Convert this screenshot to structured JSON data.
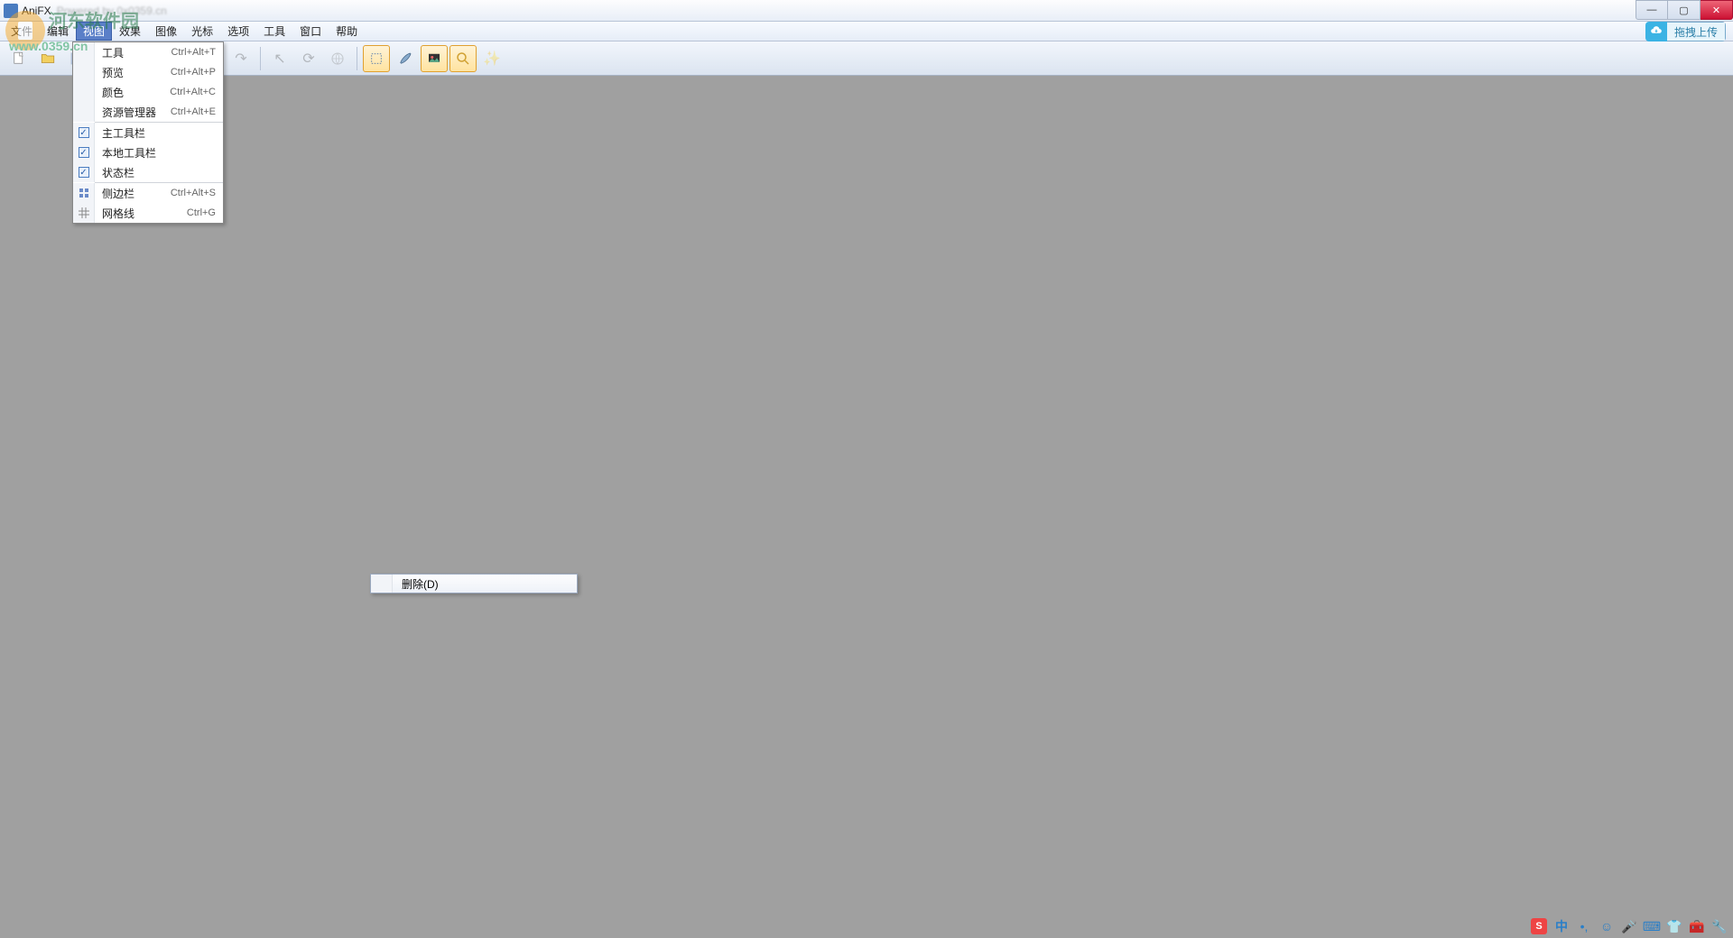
{
  "title": {
    "app": "AniFX",
    "extra": "Powered by 0x0359.cn"
  },
  "window_controls": {
    "min": "—",
    "max": "▢",
    "close": "✕"
  },
  "menubar": [
    "文件",
    "编辑",
    "视图",
    "效果",
    "图像",
    "光标",
    "选项",
    "工具",
    "窗口",
    "帮助"
  ],
  "active_menu_index": 2,
  "upload": {
    "label": "拖拽上传"
  },
  "dropdown": {
    "items": [
      {
        "label": "工具",
        "shortcut": "Ctrl+Alt+T",
        "icon": ""
      },
      {
        "label": "预览",
        "shortcut": "Ctrl+Alt+P",
        "icon": ""
      },
      {
        "label": "颜色",
        "shortcut": "Ctrl+Alt+C",
        "icon": ""
      },
      {
        "label": "资源管理器",
        "shortcut": "Ctrl+Alt+E",
        "icon": ""
      }
    ],
    "checks": [
      {
        "label": "主工具栏",
        "checked": true
      },
      {
        "label": "本地工具栏",
        "checked": true
      },
      {
        "label": "状态栏",
        "checked": true
      }
    ],
    "extras": [
      {
        "label": "侧边栏",
        "shortcut": "Ctrl+Alt+S",
        "icon": "grid"
      },
      {
        "label": "网格线",
        "shortcut": "Ctrl+G",
        "icon": "hash"
      }
    ]
  },
  "context_menu": {
    "delete": "删除(D)"
  },
  "toolbar_icons": [
    "new",
    "open",
    "save",
    "cut",
    "copy",
    "paste",
    "undo",
    "redo",
    "arrow",
    "rotate",
    "globe",
    "select",
    "brush",
    "image",
    "zoom",
    "wand"
  ],
  "tray": {
    "ime": "中"
  },
  "watermark": {
    "line1": "河东软件园",
    "line2": "www.0359.cn"
  }
}
